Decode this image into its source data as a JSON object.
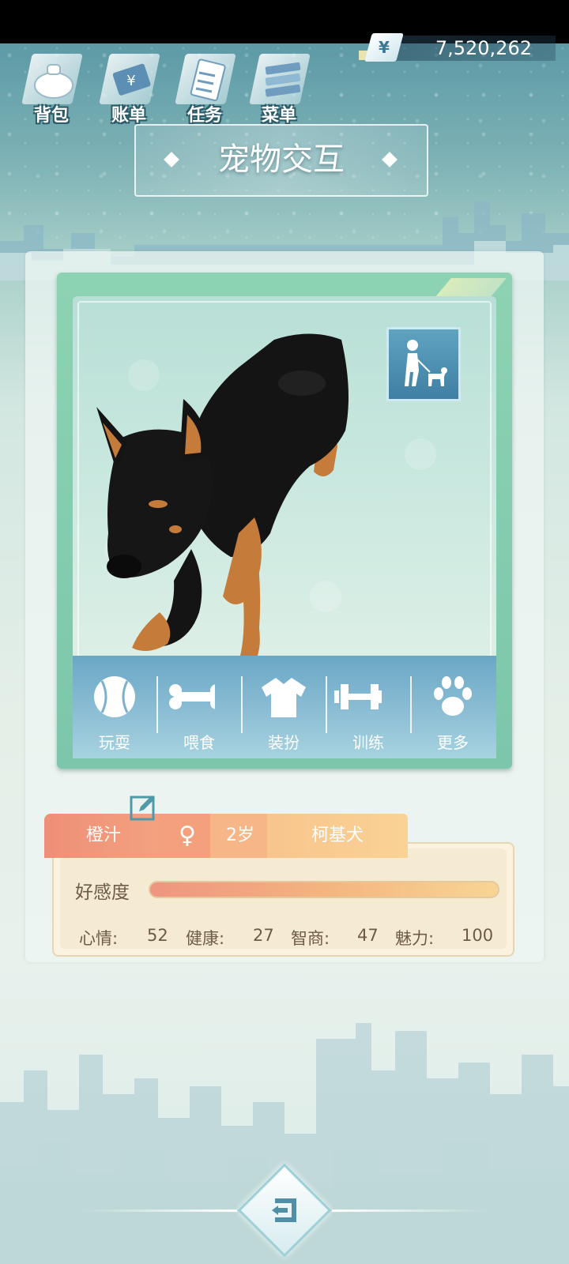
{
  "hud": {
    "buttons": [
      {
        "label": "背包",
        "icon": "bag-icon"
      },
      {
        "label": "账单",
        "icon": "bill-icon"
      },
      {
        "label": "任务",
        "icon": "task-icon"
      },
      {
        "label": "菜单",
        "icon": "menu-icon"
      }
    ],
    "currency_symbol": "¥",
    "money": "7,520,262"
  },
  "title": "宠物交互",
  "actions": [
    {
      "label": "玩耍",
      "icon": "ball-icon"
    },
    {
      "label": "喂食",
      "icon": "bone-icon"
    },
    {
      "label": "装扮",
      "icon": "shirt-icon"
    },
    {
      "label": "训练",
      "icon": "dumbbell-icon"
    },
    {
      "label": "更多",
      "icon": "paw-icon"
    }
  ],
  "walk_icon": "walk-dog-icon",
  "pet": {
    "name": "橙汁",
    "gender_symbol": "♀",
    "age": "2岁",
    "breed": "柯基犬",
    "affection_label": "好感度",
    "affection_level": 1.0,
    "stats": {
      "mood_label": "心情:",
      "mood": "52",
      "health_label": "健康:",
      "health": "27",
      "iq_label": "智商:",
      "iq": "47",
      "charm_label": "魅力:",
      "charm": "100"
    }
  },
  "colors": {
    "accent_teal": "#7cc6ab",
    "action_bar": "#6aa7c5",
    "tab_coral": "#ee8f77",
    "tab_yellow": "#fad296"
  }
}
